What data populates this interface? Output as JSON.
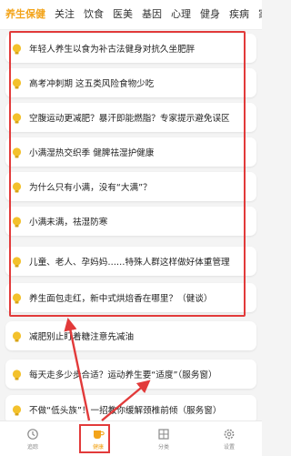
{
  "tabs": [
    {
      "label": "养生保健",
      "active": true
    },
    {
      "label": "关注"
    },
    {
      "label": "饮食"
    },
    {
      "label": "医美"
    },
    {
      "label": "基因"
    },
    {
      "label": "心理"
    },
    {
      "label": "健身"
    },
    {
      "label": "疾病"
    },
    {
      "label": "家居"
    }
  ],
  "articles": [
    "年轻人养生以食为补古法健身对抗久坐肥胖",
    "高考冲刺期 这五类风险食物少吃",
    "空腹运动更减肥？暴汗即能燃脂？专家提示避免误区",
    "小满湿热交织季 健脾祛湿护健康",
    "为什么只有小满，没有“大满”？",
    "小满未满，祛湿防寒",
    "儿童、老人、孕妈妈……特殊人群这样做好体重管理",
    "养生面包走红，新中式烘焙香在哪里？（健谈）",
    "减肥别止盯着糖注意先减油",
    "每天走多少步合适？运动养生要“适度”（服务窗）",
    "不做“低头族”！一招教你缓解颈椎前倾（服务窗）"
  ],
  "bottom_nav": [
    {
      "label": "追踪",
      "icon": "history-icon"
    },
    {
      "label": "健康",
      "icon": "cup-icon",
      "active": true
    },
    {
      "label": "分类",
      "icon": "grid-icon"
    },
    {
      "label": "设置",
      "icon": "gear-icon"
    }
  ],
  "colors": {
    "accent": "#f3a41a",
    "annotation": "#e23a3a",
    "bulb": "#f3c12c"
  }
}
